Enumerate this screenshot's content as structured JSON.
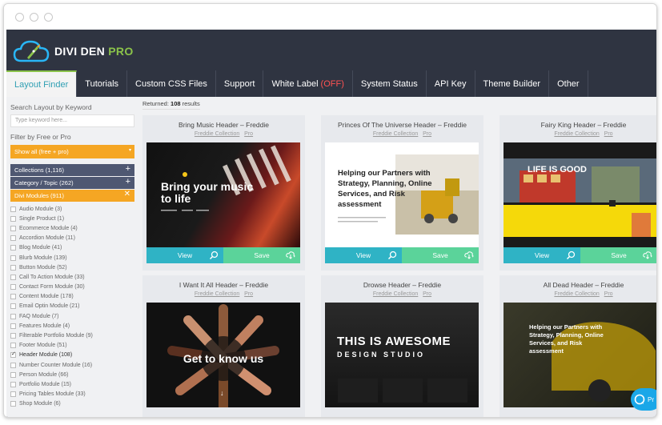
{
  "brand": {
    "name": "DIVI DEN",
    "pro": "PRO"
  },
  "nav": [
    {
      "label": "Layout Finder"
    },
    {
      "label": "Tutorials"
    },
    {
      "label": "Custom CSS Files"
    },
    {
      "label": "Support"
    },
    {
      "label": "White Label",
      "suffix": "(OFF)"
    },
    {
      "label": "System Status"
    },
    {
      "label": "API Key"
    },
    {
      "label": "Theme Builder"
    },
    {
      "label": "Other"
    }
  ],
  "sidebar": {
    "search_label": "Search Layout by Keyword",
    "search_placeholder": "Type keyword here...",
    "filter_label": "Filter by Free or Pro",
    "filter_value": "Show all (free + pro)",
    "collections": "Collections (1,116)",
    "category": "Category / Topic (262)",
    "divi_modules": "Divi Modules (911)",
    "modules": [
      {
        "label": "Audio Module (3)",
        "checked": false
      },
      {
        "label": "Single Product (1)",
        "checked": false
      },
      {
        "label": "Ecommerce Module (4)",
        "checked": false
      },
      {
        "label": "Accordion Module (11)",
        "checked": false
      },
      {
        "label": "Blog Module (41)",
        "checked": false
      },
      {
        "label": "Blurb Module (139)",
        "checked": false
      },
      {
        "label": "Button Module (52)",
        "checked": false
      },
      {
        "label": "Call To Action Module (33)",
        "checked": false
      },
      {
        "label": "Contact Form Module (30)",
        "checked": false
      },
      {
        "label": "Content Module (178)",
        "checked": false
      },
      {
        "label": "Email Optin Module (21)",
        "checked": false
      },
      {
        "label": "FAQ Module (7)",
        "checked": false
      },
      {
        "label": "Features Module (4)",
        "checked": false
      },
      {
        "label": "Filterable Portfolio Module (9)",
        "checked": false
      },
      {
        "label": "Footer Module (51)",
        "checked": false
      },
      {
        "label": "Header Module (108)",
        "checked": true
      },
      {
        "label": "Number Counter Module (16)",
        "checked": false
      },
      {
        "label": "Person Module (66)",
        "checked": false
      },
      {
        "label": "Portfolio Module (15)",
        "checked": false
      },
      {
        "label": "Pricing Tables Module (33)",
        "checked": false
      },
      {
        "label": "Shop Module (6)",
        "checked": false
      }
    ]
  },
  "results": {
    "prefix": "Returned:",
    "count": "108",
    "suffix": "results"
  },
  "cards": [
    {
      "title": "Bring Music Header – Freddie",
      "collection": "Freddie Collection",
      "tier": "Pro",
      "thumb_title": "Bring your music to life"
    },
    {
      "title": "Princes Of The Universe Header – Freddie",
      "collection": "Freddie Collection",
      "tier": "Pro",
      "thumb_title": "Helping our Partners with Strategy, Planning, Online Services, and Risk assessment"
    },
    {
      "title": "Fairy King Header – Freddie",
      "collection": "Freddie Collection",
      "tier": "Pro",
      "thumb_title": "LIFE IS GOOD"
    },
    {
      "title": "I Want It All Header – Freddie",
      "collection": "Freddie Collection",
      "tier": "Pro",
      "thumb_title": "Get to know us"
    },
    {
      "title": "Drowse Header – Freddie",
      "collection": "Freddie Collection",
      "tier": "Pro",
      "thumb_title": "THIS IS AWESOME",
      "thumb_sub": "DESIGN STUDIO"
    },
    {
      "title": "All Dead Header – Freddie",
      "collection": "Freddie Collection",
      "tier": "Pro",
      "thumb_title": "Helping our Partners with Strategy, Planning, Online Services, and Risk assessment"
    }
  ],
  "buttons": {
    "view": "View",
    "save": "Save"
  },
  "chat": {
    "label": "Pr"
  },
  "colors": {
    "nav_bg": "#2f3441",
    "accent_teal": "#2fb3c5",
    "accent_green": "#5bd39a",
    "accent_orange": "#f5a623",
    "brand_green": "#8bc34a"
  },
  "icons": [
    "rocket-cloud-logo-icon",
    "plus-icon",
    "close-icon",
    "zoom-icon",
    "download-icon",
    "chat-icon"
  ]
}
